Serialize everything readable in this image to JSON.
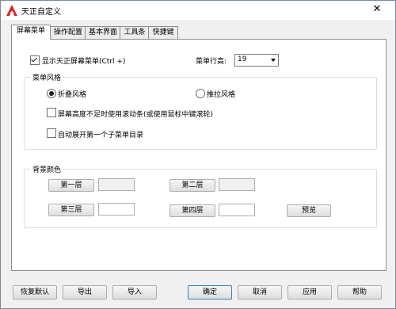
{
  "window": {
    "title": "天正自定义",
    "close_symbol": "✕"
  },
  "tabs": [
    {
      "label": "屏幕菜单",
      "active": true
    },
    {
      "label": "操作配置",
      "active": false
    },
    {
      "label": "基本界面",
      "active": false
    },
    {
      "label": "工具条",
      "active": false
    },
    {
      "label": "快捷键",
      "active": false
    }
  ],
  "screen_menu": {
    "show_menu": {
      "label": "显示天正屏幕菜单(Ctrl +)",
      "checked": true
    },
    "rows": {
      "label": "菜单行高:",
      "value": "19"
    },
    "style_group": {
      "title": "菜单风格",
      "fold": {
        "label": "折叠风格",
        "selected": true
      },
      "pull": {
        "label": "推拉风格",
        "selected": false
      },
      "scroll": {
        "label": "屏幕高度不足时使用滚动条(或使用鼠标中键滚轮)",
        "checked": false
      },
      "auto_expand": {
        "label": "自动展开第一个子菜单目录",
        "checked": false
      }
    },
    "bg_group": {
      "title": "背景颜色",
      "level1": "第一层",
      "level2": "第二层",
      "level3": "第三层",
      "level4": "第四层",
      "preview": "预览"
    }
  },
  "footer": {
    "restore": "恢复默认",
    "export": "导出",
    "import": "导入",
    "ok": "确定",
    "cancel": "取消",
    "apply": "应用",
    "help": "帮助"
  },
  "colors": {
    "accent": "#1e6fd9",
    "swatch_gray": "#f0f0f0",
    "swatch_white": "#ffffff",
    "app_icon": "#d22a2a"
  }
}
